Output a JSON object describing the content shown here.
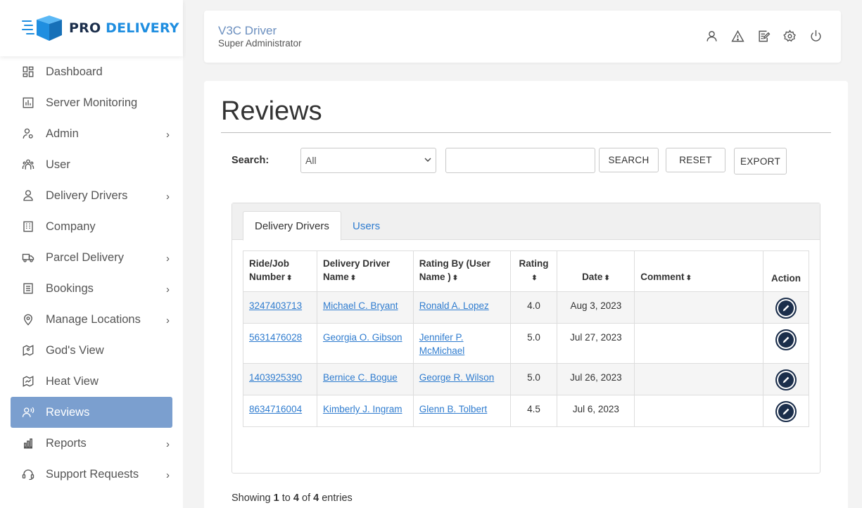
{
  "brand": {
    "pro": "PRO",
    "delivery": "DELIVERY",
    "colors": {
      "navy": "#1b2e4b",
      "blue": "#1f8ee0",
      "active": "#7b9fcf"
    }
  },
  "sidebar": {
    "items": [
      {
        "label": "Dashboard",
        "icon": "dashboard-icon",
        "chevron": false
      },
      {
        "label": "Server Monitoring",
        "icon": "chart-icon",
        "chevron": false
      },
      {
        "label": "Admin",
        "icon": "admin-icon",
        "chevron": true
      },
      {
        "label": "User",
        "icon": "users-icon",
        "chevron": false
      },
      {
        "label": "Delivery Drivers",
        "icon": "driver-icon",
        "chevron": true
      },
      {
        "label": "Company",
        "icon": "building-icon",
        "chevron": false
      },
      {
        "label": "Parcel Delivery",
        "icon": "truck-icon",
        "chevron": true
      },
      {
        "label": "Bookings",
        "icon": "list-icon",
        "chevron": true
      },
      {
        "label": "Manage Locations",
        "icon": "location-pin-icon",
        "chevron": true
      },
      {
        "label": "God's View",
        "icon": "map-icon",
        "chevron": false
      },
      {
        "label": "Heat View",
        "icon": "heat-map-icon",
        "chevron": false
      },
      {
        "label": "Reviews",
        "icon": "reviews-icon",
        "chevron": false,
        "active": true
      },
      {
        "label": "Reports",
        "icon": "bar-chart-icon",
        "chevron": true
      },
      {
        "label": "Support Requests",
        "icon": "headset-icon",
        "chevron": true
      }
    ],
    "chevron_glyph": "›"
  },
  "header": {
    "name": "V3C Driver",
    "role": "Super Administrator",
    "icons": [
      "user-icon",
      "warning-icon",
      "edit-note-icon",
      "settings-icon",
      "power-icon"
    ]
  },
  "page": {
    "title": "Reviews",
    "search_label": "Search:",
    "select_value": "All",
    "search_input_value": "",
    "buttons": {
      "search": "SEARCH",
      "reset": "RESET",
      "export": "EXPORT"
    }
  },
  "tabs": [
    {
      "label": "Delivery Drivers",
      "active": true
    },
    {
      "label": "Users",
      "active": false
    }
  ],
  "table": {
    "headers": [
      "Ride/Job Number",
      "Delivery Driver Name",
      "Rating By (User Name )",
      "Rating",
      "Date",
      "Comment",
      "Action"
    ],
    "rows": [
      {
        "job": "3247403713",
        "driver": "Michael C. Bryant",
        "rater": "Ronald A. Lopez",
        "rating": "4.0",
        "date": "Aug 3, 2023",
        "comment": ""
      },
      {
        "job": "5631476028",
        "driver": "Georgia O. Gibson",
        "rater": "Jennifer P. McMichael",
        "rating": "5.0",
        "date": "Jul 27, 2023",
        "comment": ""
      },
      {
        "job": "1403925390",
        "driver": "Bernice C. Bogue",
        "rater": "George R. Wilson",
        "rating": "5.0",
        "date": "Jul 26, 2023",
        "comment": ""
      },
      {
        "job": "8634716004",
        "driver": "Kimberly J. Ingram",
        "rater": "Glenn B. Tolbert",
        "rating": "4.5",
        "date": "Jul 6, 2023",
        "comment": ""
      }
    ]
  },
  "footer": {
    "showing": "Showing",
    "from": "1",
    "to_word": "to",
    "to": "4",
    "of_word": "of",
    "total": "4",
    "entries": "entries"
  }
}
